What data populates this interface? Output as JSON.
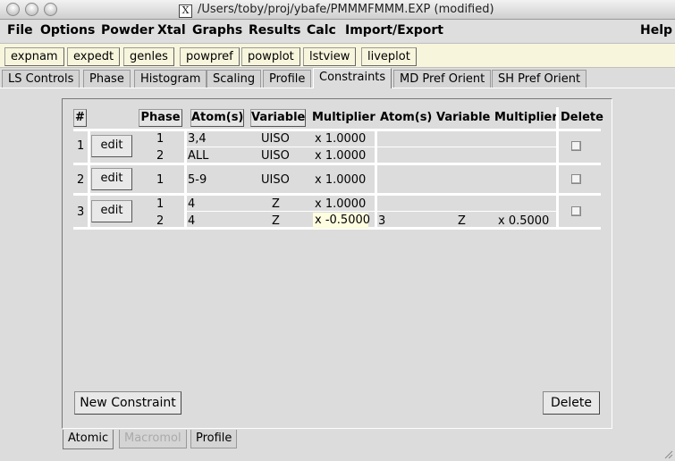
{
  "window": {
    "title": "/Users/toby/proj/ybafe/PMMMFMMM.EXP (modified)",
    "x_icon": "X"
  },
  "menubar": {
    "items": [
      "File",
      "Options",
      "Powder",
      "Xtal",
      "Graphs",
      "Results",
      "Calc",
      "Import/Export"
    ],
    "help": "Help"
  },
  "toolbar": {
    "buttons": [
      "expnam",
      "expedt",
      "genles",
      "powpref",
      "powplot",
      "lstview",
      "liveplot"
    ]
  },
  "tabs": {
    "items": [
      "LS Controls",
      "Phase",
      "Histogram",
      "Scaling",
      "Profile",
      "Constraints",
      "MD Pref Orient",
      "SH Pref Orient"
    ],
    "active": "Constraints"
  },
  "constraints": {
    "headers": {
      "num": "#",
      "phase": "Phase",
      "atoms": "Atom(s)",
      "variable": "Variable",
      "multiplier": "Multiplier",
      "atoms2": "Atom(s)",
      "variable2": "Variable",
      "multiplier2": "Multiplier",
      "delete": "Delete"
    },
    "edit_label": "edit",
    "groups": [
      {
        "num": "1",
        "rows": [
          {
            "phase": "1",
            "atoms": "3,4",
            "variable": "UISO",
            "multiplier": "x 1.0000",
            "atoms2": "",
            "variable2": "",
            "multiplier2": ""
          },
          {
            "phase": "2",
            "atoms": "ALL",
            "variable": "UISO",
            "multiplier": "x 1.0000",
            "atoms2": "",
            "variable2": "",
            "multiplier2": ""
          }
        ]
      },
      {
        "num": "2",
        "rows": [
          {
            "phase": "1",
            "atoms": "5-9",
            "variable": "UISO",
            "multiplier": "x 1.0000",
            "atoms2": "",
            "variable2": "",
            "multiplier2": ""
          }
        ]
      },
      {
        "num": "3",
        "rows": [
          {
            "phase": "1",
            "atoms": "4",
            "variable": "Z",
            "multiplier": "x 1.0000",
            "atoms2": "",
            "variable2": "",
            "multiplier2": ""
          },
          {
            "phase": "2",
            "atoms": "4",
            "variable": "Z",
            "multiplier": "x -0.5000",
            "atoms2": "3",
            "variable2": "Z",
            "multiplier2": "x 0.5000"
          }
        ]
      }
    ],
    "new_button": "New Constraint",
    "delete_button": "Delete"
  },
  "bottom_tabs": {
    "items": [
      "Atomic",
      "Macromol",
      "Profile"
    ],
    "active": "Atomic",
    "disabled": [
      "Macromol"
    ]
  }
}
